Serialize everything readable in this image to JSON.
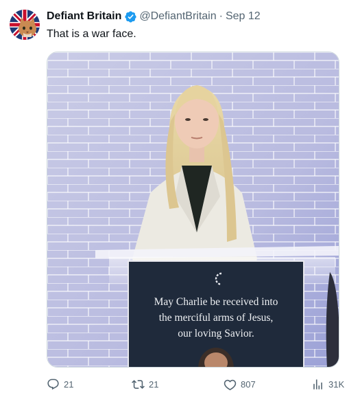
{
  "author": {
    "display_name": "Defiant Britain",
    "handle": "@DefiantBritain",
    "separator": "·",
    "date": "Sep 12",
    "verified_color": "#1d9bf0"
  },
  "tweet": {
    "text": "That is a war face."
  },
  "media": {
    "podium_text_lines": [
      "May Charlie be received into",
      "the merciful arms of Jesus,",
      "our loving Savior."
    ]
  },
  "actions": {
    "replies": "21",
    "retweets": "21",
    "likes": "807",
    "views": "31K"
  },
  "icons": {
    "reply": "reply-icon",
    "retweet": "retweet-icon",
    "like": "heart-icon",
    "views": "analytics-icon",
    "verified": "verified-badge-icon"
  }
}
